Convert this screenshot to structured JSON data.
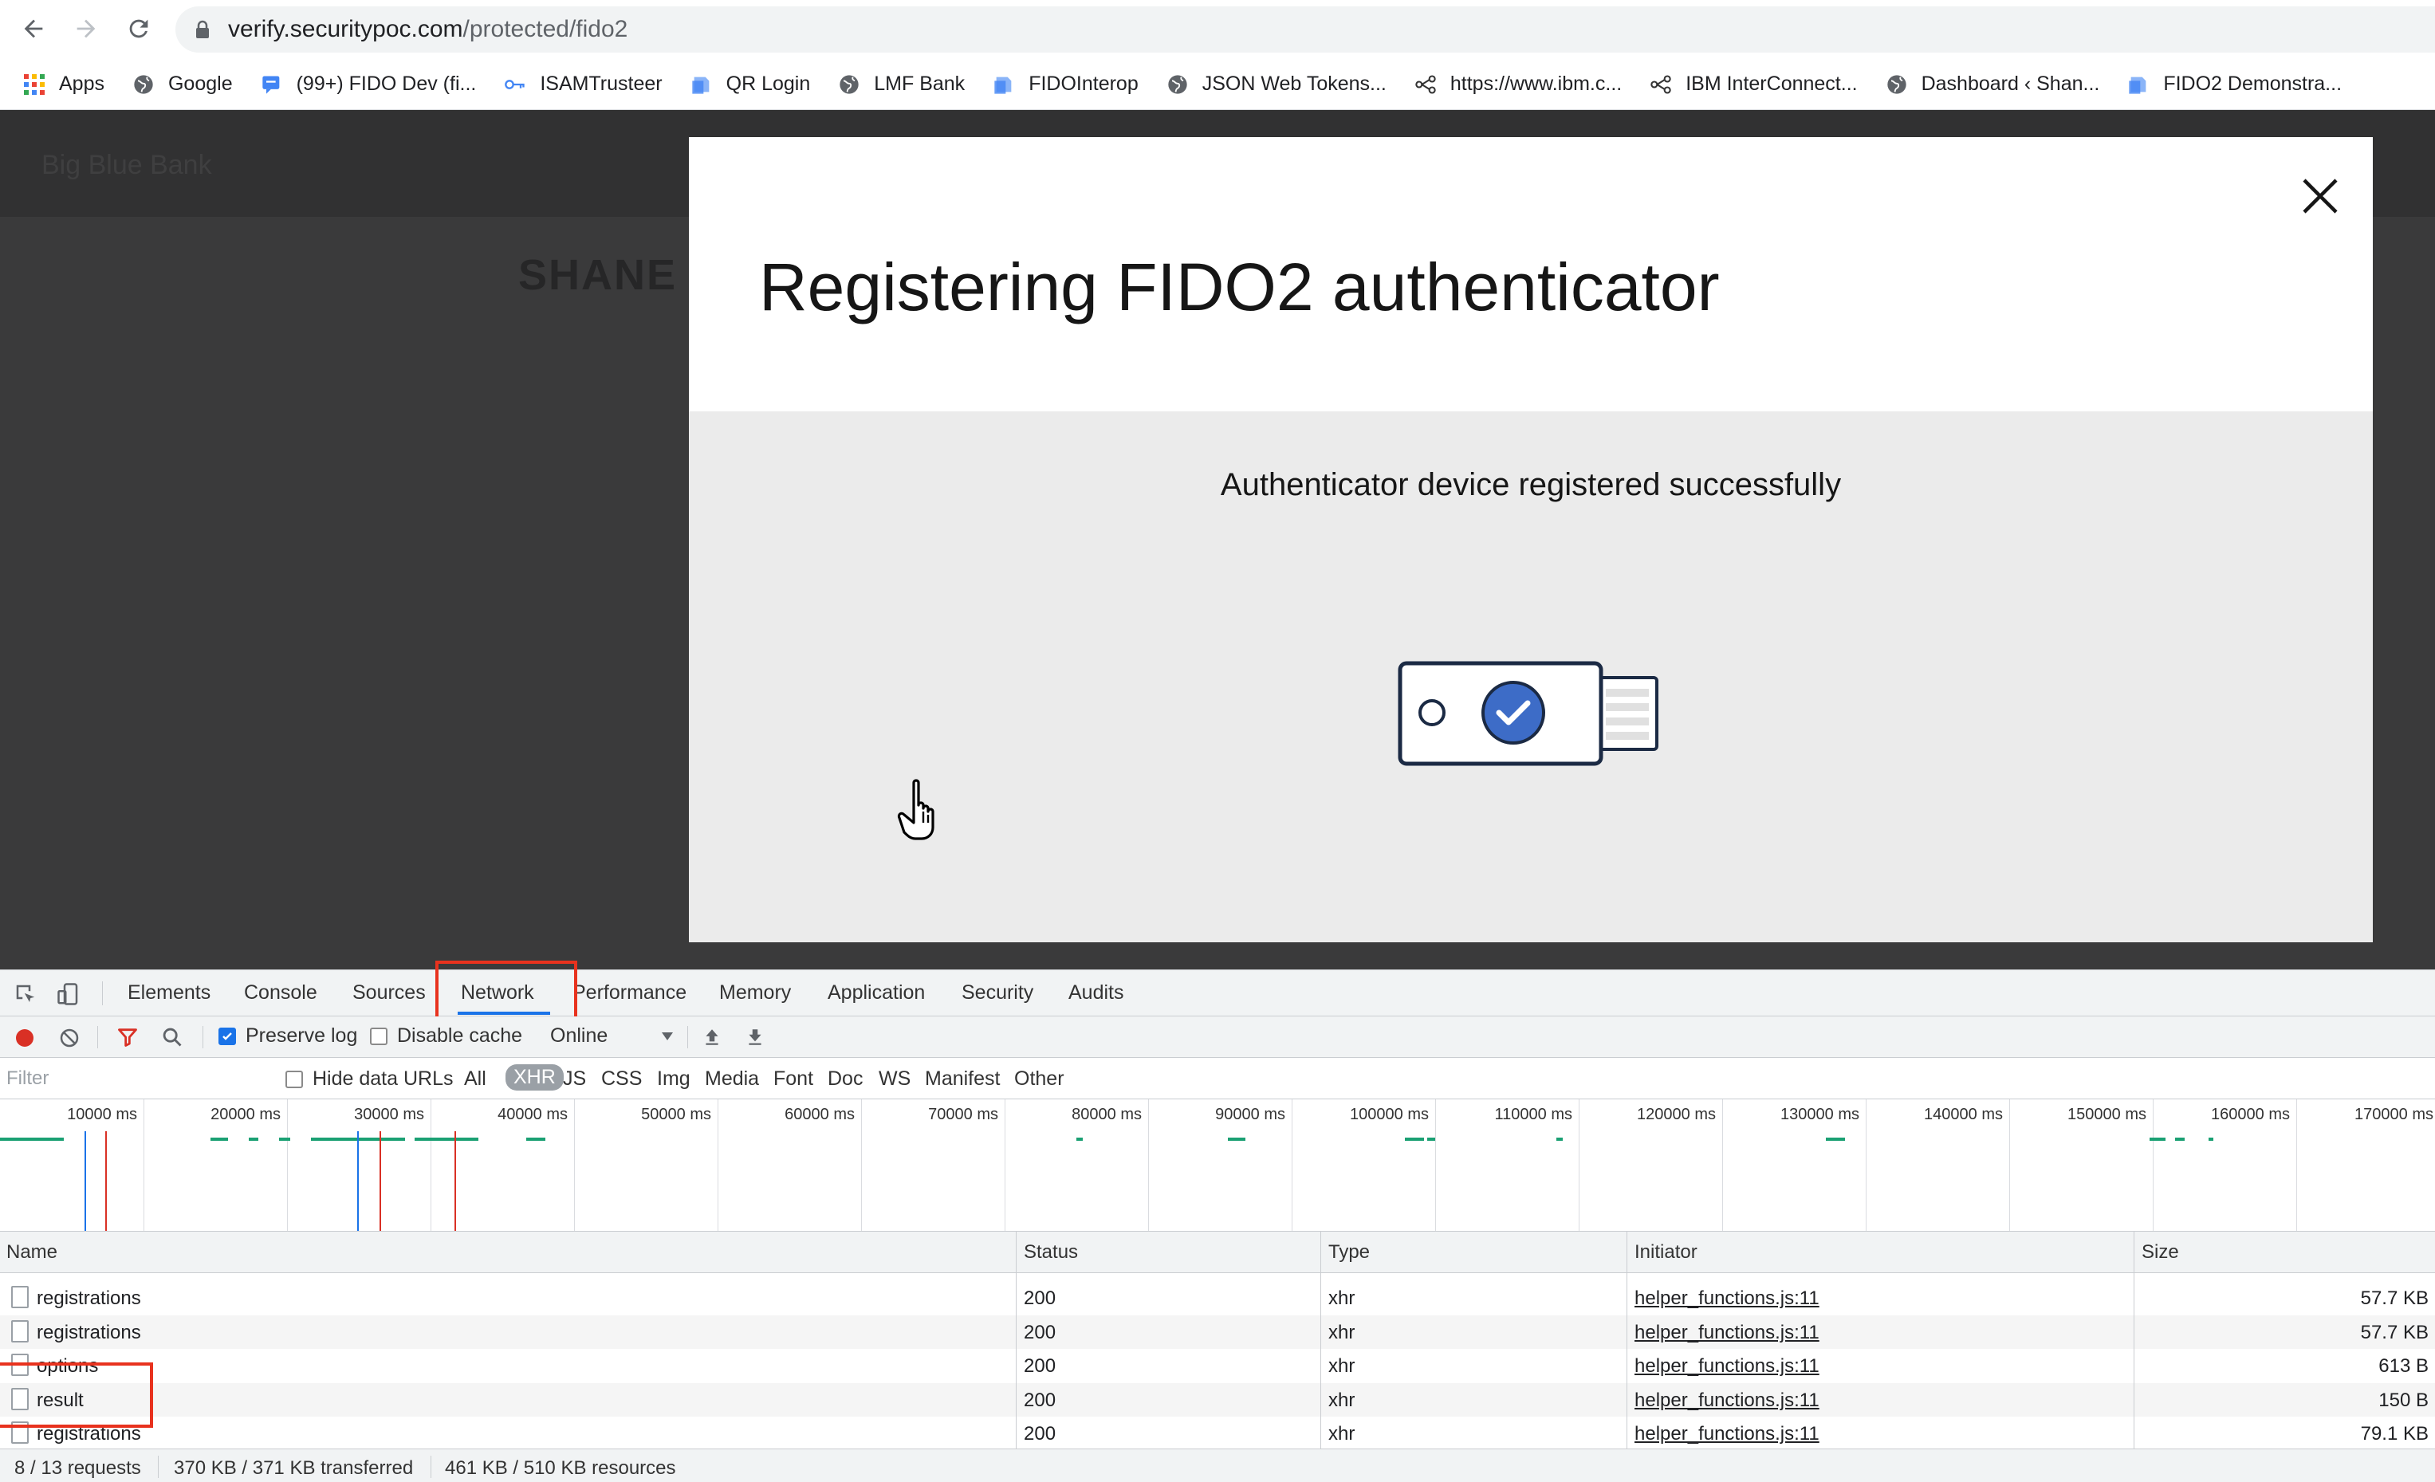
{
  "browser": {
    "url_host": "verify.securitypoc.com",
    "url_path": "/protected/fido2"
  },
  "bookmarks": [
    {
      "label": "Apps",
      "icon": "apps-grid-icon"
    },
    {
      "label": "Google",
      "icon": "globe-icon"
    },
    {
      "label": "(99+) FIDO Dev (fi...",
      "icon": "chat-icon"
    },
    {
      "label": "ISAMTrusteer",
      "icon": "key-icon"
    },
    {
      "label": "QR Login",
      "icon": "page-icon"
    },
    {
      "label": "LMF Bank",
      "icon": "globe-icon"
    },
    {
      "label": "FIDOInterop",
      "icon": "page-icon"
    },
    {
      "label": "JSON Web Tokens...",
      "icon": "globe-icon"
    },
    {
      "label": "https://www.ibm.c...",
      "icon": "network-icon"
    },
    {
      "label": "IBM InterConnect...",
      "icon": "network-icon"
    },
    {
      "label": "Dashboard ‹ Shan...",
      "icon": "globe-icon"
    },
    {
      "label": "FIDO2 Demonstra...",
      "icon": "page-icon"
    }
  ],
  "page": {
    "brand": "Big Blue Bank",
    "user_name": "SHANE W"
  },
  "modal": {
    "title": "Registering FIDO2 authenticator",
    "message": "Authenticator device registered successfully",
    "accent_color": "#3d6cc7"
  },
  "devtools": {
    "tabs": [
      "Elements",
      "Console",
      "Sources",
      "Network",
      "Performance",
      "Memory",
      "Application",
      "Security",
      "Audits"
    ],
    "active_tab": "Network",
    "controls": {
      "preserve_log": "Preserve log",
      "preserve_log_checked": true,
      "disable_cache": "Disable cache",
      "disable_cache_checked": false,
      "throttling": "Online"
    },
    "filter": {
      "placeholder": "Filter",
      "hide_data_urls": "Hide data URLs",
      "types": [
        "All",
        "XHR",
        "JS",
        "CSS",
        "Img",
        "Media",
        "Font",
        "Doc",
        "WS",
        "Manifest",
        "Other"
      ],
      "selected_type": "XHR"
    },
    "overview_ticks": [
      "10000 ms",
      "20000 ms",
      "30000 ms",
      "40000 ms",
      "50000 ms",
      "60000 ms",
      "70000 ms",
      "80000 ms",
      "90000 ms",
      "100000 ms",
      "110000 ms",
      "120000 ms",
      "130000 ms",
      "140000 ms",
      "150000 ms",
      "160000 ms",
      "170000 ms"
    ],
    "columns": {
      "name": "Name",
      "status": "Status",
      "type": "Type",
      "initiator": "Initiator",
      "size": "Size"
    },
    "rows": [
      {
        "name": "registrations",
        "status": "200",
        "type": "xhr",
        "initiator": "helper_functions.js:11",
        "size": "57.7 KB"
      },
      {
        "name": "registrations",
        "status": "200",
        "type": "xhr",
        "initiator": "helper_functions.js:11",
        "size": "57.7 KB"
      },
      {
        "name": "options",
        "status": "200",
        "type": "xhr",
        "initiator": "helper_functions.js:11",
        "size": "613 B"
      },
      {
        "name": "result",
        "status": "200",
        "type": "xhr",
        "initiator": "helper_functions.js:11",
        "size": "150 B"
      },
      {
        "name": "registrations",
        "status": "200",
        "type": "xhr",
        "initiator": "helper_functions.js:11",
        "size": "79.1 KB"
      }
    ],
    "status_bar": {
      "requests": "8 / 13 requests",
      "transferred": "370 KB / 371 KB transferred",
      "resources": "461 KB / 510 KB resources"
    }
  }
}
